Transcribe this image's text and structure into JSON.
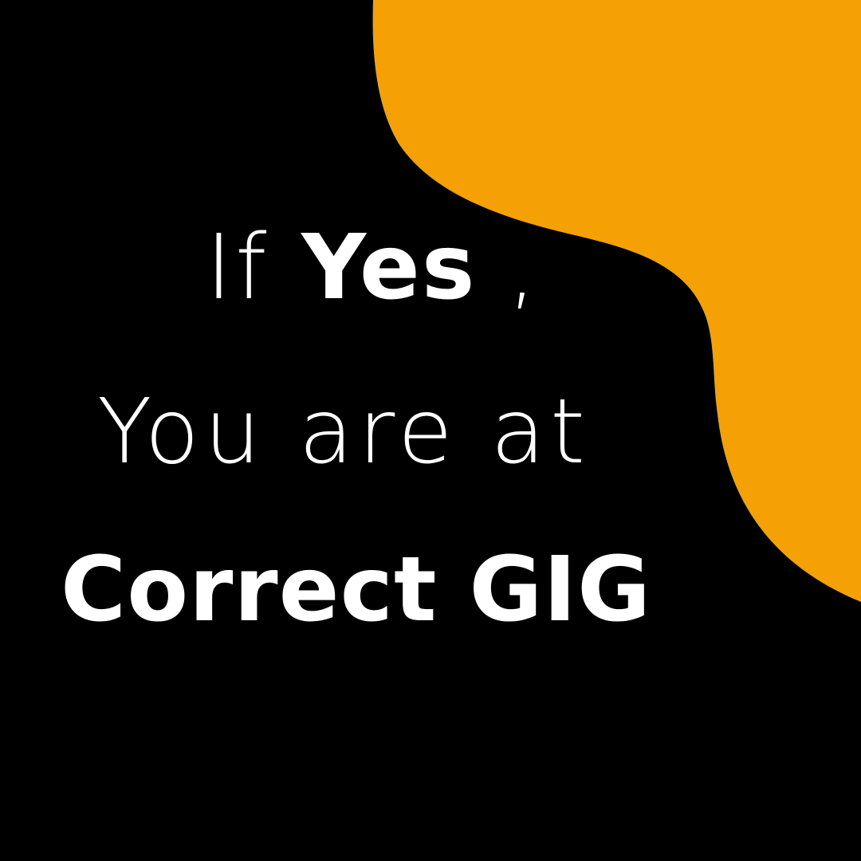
{
  "headline": {
    "line1_prefix": "If ",
    "line1_bold": "Yes",
    "line1_suffix": " ,",
    "line2": "You are at",
    "line3": "Correct GIG"
  },
  "colors": {
    "background": "#000000",
    "accent_blob": "#F5A005",
    "text": "#FFFFFF"
  }
}
